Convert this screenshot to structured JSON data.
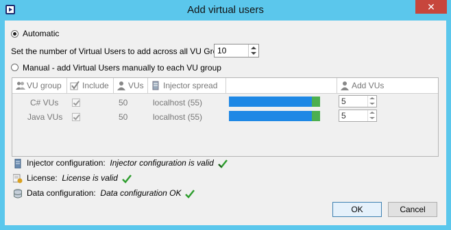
{
  "window": {
    "title": "Add virtual users",
    "close_label": "✕"
  },
  "automatic": {
    "label": "Automatic",
    "selected": true,
    "count_label": "Set the number of Virtual Users to add across all VU Groups:",
    "count_value": "10"
  },
  "manual": {
    "label": "Manual - add Virtual Users manually to each VU group",
    "selected": false
  },
  "grid": {
    "columns": [
      "VU group",
      "Include",
      "VUs",
      "Injector spread",
      "",
      "Add VUs"
    ],
    "rows": [
      {
        "group": "C# VUs",
        "include": true,
        "vus": "50",
        "injector": "localhost (55)",
        "bar_fill": 0.91,
        "add_vus": "5"
      },
      {
        "group": "Java VUs",
        "include": true,
        "vus": "50",
        "injector": "localhost (55)",
        "bar_fill": 0.91,
        "add_vus": "5"
      }
    ],
    "bar_colors": {
      "blue": "#1e88e5",
      "green": "#4caf50"
    }
  },
  "status": [
    {
      "icon": "server-icon",
      "label": "Injector configuration:",
      "value": "Injector configuration is valid"
    },
    {
      "icon": "license-icon",
      "label": "License:",
      "value": "License is valid"
    },
    {
      "icon": "database-icon",
      "label": "Data configuration:",
      "value": "Data configuration OK"
    }
  ],
  "buttons": {
    "ok": "OK",
    "cancel": "Cancel"
  }
}
